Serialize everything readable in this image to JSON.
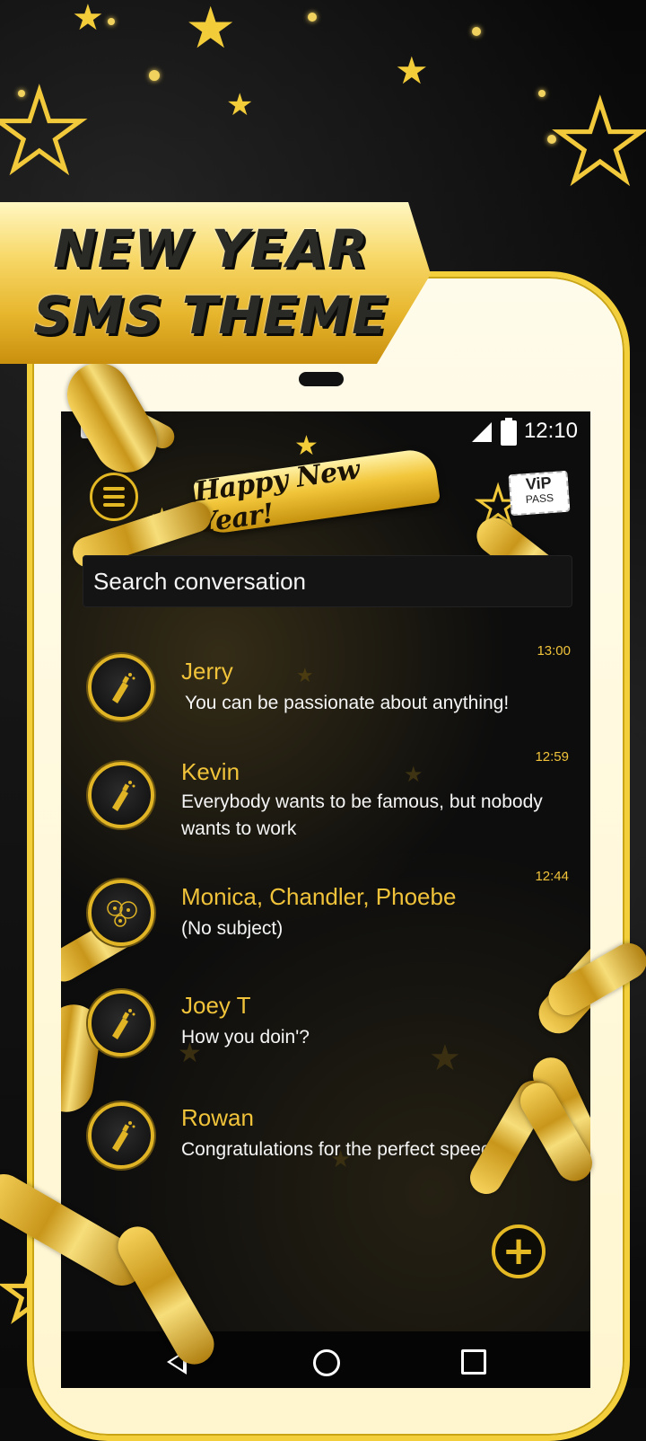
{
  "promo": {
    "line1": "NEW YEAR",
    "line2": "SMS THEME"
  },
  "status_bar": {
    "time": "12:10"
  },
  "header": {
    "banner": "Happy New Year!",
    "vip_top": "ViP",
    "vip_bottom": "PASS"
  },
  "search": {
    "placeholder": "Search conversation"
  },
  "conversations": [
    {
      "name": "Jerry",
      "message": "You can be passionate about anything!",
      "time": "13:00",
      "avatar": "champagne-icon"
    },
    {
      "name": "Kevin",
      "message": "Everybody wants to be famous, but nobody wants to work",
      "time": "12:59",
      "avatar": "champagne-icon"
    },
    {
      "name": "Monica, Chandler, Phoebe",
      "message": "(No subject)",
      "time": "12:44",
      "avatar": "fireworks-icon"
    },
    {
      "name": "Joey T",
      "message": "How you doin'?",
      "time": "",
      "avatar": "champagne-icon"
    },
    {
      "name": "Rowan",
      "message": "Congratulations for the perfect speech h",
      "time": "",
      "avatar": "champagne-icon"
    }
  ],
  "fab": {
    "icon": "plus-icon"
  },
  "colors": {
    "accent_gold": "#f0c33a",
    "background": "#0d0d0d",
    "text": "#f5f5f5"
  }
}
